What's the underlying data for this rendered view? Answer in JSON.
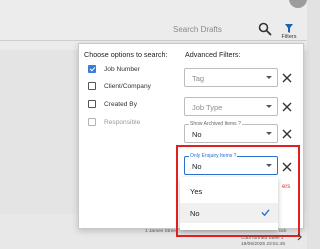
{
  "search": {
    "placeholder": "Search Drafts"
  },
  "toolbar": {
    "filters_label": "Filters"
  },
  "filter_panel": {
    "options_heading": "Choose options to search:",
    "options": [
      {
        "label": "Job Number",
        "checked": true,
        "disabled": false
      },
      {
        "label": "Client/Company",
        "checked": false,
        "disabled": false
      },
      {
        "label": "Created By",
        "checked": false,
        "disabled": false
      },
      {
        "label": "Responsible",
        "checked": false,
        "disabled": true
      }
    ],
    "advanced_heading": "Advanced Filters:",
    "tag": {
      "placeholder": "Tag"
    },
    "job_type": {
      "placeholder": "Job Type"
    },
    "show_archived": {
      "label": "Show Archived Items ?",
      "value": "No"
    },
    "only_enquiry": {
      "label": "Only Enquiry Items ?",
      "value": "No"
    },
    "hint_text": "ers"
  },
  "dropdown": {
    "options": [
      {
        "label": "Yes",
        "selected": false
      },
      {
        "label": "No",
        "selected": true
      }
    ]
  },
  "background_rows": {
    "address": "1 James Stree",
    "right_fragment": "ock",
    "person": "Cobi formed Steel 1",
    "timestamp": "19/06/2025 23:51:45"
  },
  "colors": {
    "accent": "#2d6fd0",
    "highlight": "#e02020",
    "checkbox": "#3c7bd6"
  }
}
